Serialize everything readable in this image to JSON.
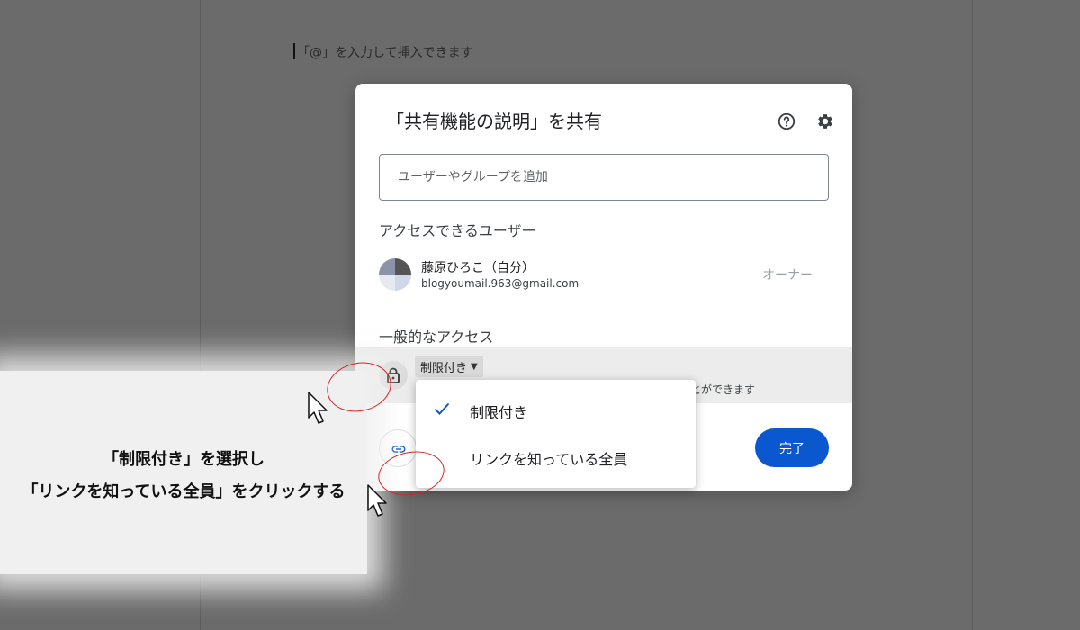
{
  "doc": {
    "hint": "「@」を入力して挿入できます"
  },
  "dialog": {
    "title": "「共有機能の説明」を共有",
    "add_placeholder": "ユーザーやグループを追加",
    "access_heading": "アクセスできるユーザー",
    "user": {
      "name": "藤原ひろこ（自分）",
      "email": "blogyoumail.963@gmail.com",
      "role": "オーナー"
    },
    "general_heading": "一般的なアクセス",
    "restriction": {
      "selected": "制限付き"
    },
    "access_desc": "とができます",
    "done_label": "完了"
  },
  "dropdown": {
    "options": [
      {
        "label": "制限付き",
        "checked": true
      },
      {
        "label": "リンクを知っている全員",
        "checked": false
      }
    ]
  },
  "tip": {
    "line1": "「制限付き」を選択し",
    "line2": "「リンクを知っている全員」をクリックする"
  },
  "colors": {
    "accent": "#0b57d0",
    "annotation": "#e02020",
    "overlay": "#6b6b6b"
  }
}
